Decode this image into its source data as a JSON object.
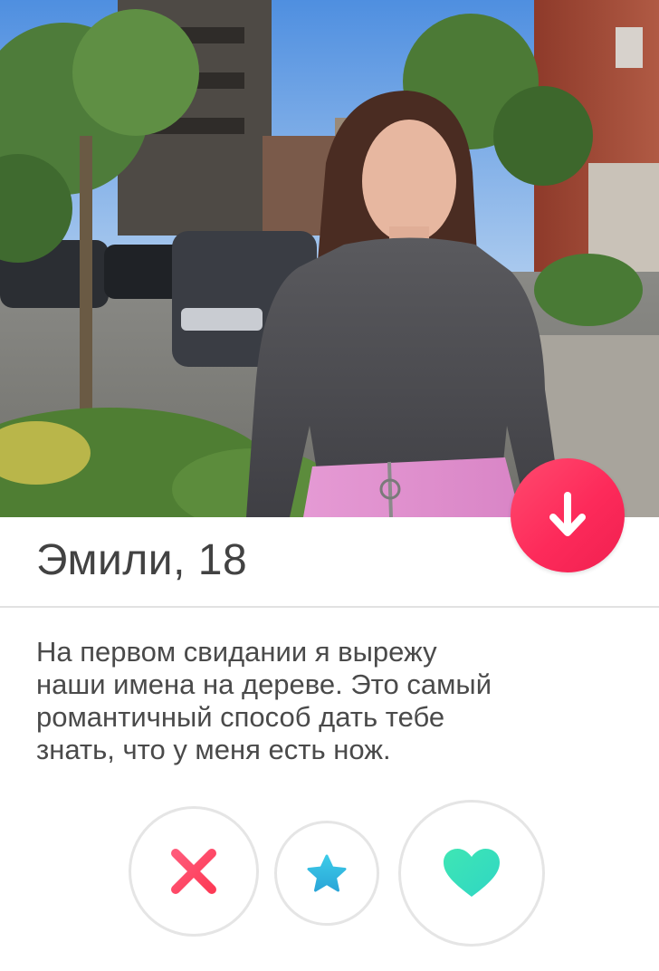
{
  "profile": {
    "name_age": "Эмили, 18",
    "bio_lines": [
      "На первом свидании я вырежу",
      "наши имена на дереве. Это самый",
      "романтичный способ дать тебе",
      "знать, что у меня есть нож."
    ]
  },
  "icons": {
    "info": "arrow-down-icon",
    "nope": "close-icon",
    "superlike": "star-icon",
    "like": "heart-icon"
  },
  "colors": {
    "info_button": "#fd2a5a",
    "nope": "#ff3c5f",
    "superlike": "#2fb8e0",
    "like": "#3ce0b8",
    "text": "#424242"
  }
}
